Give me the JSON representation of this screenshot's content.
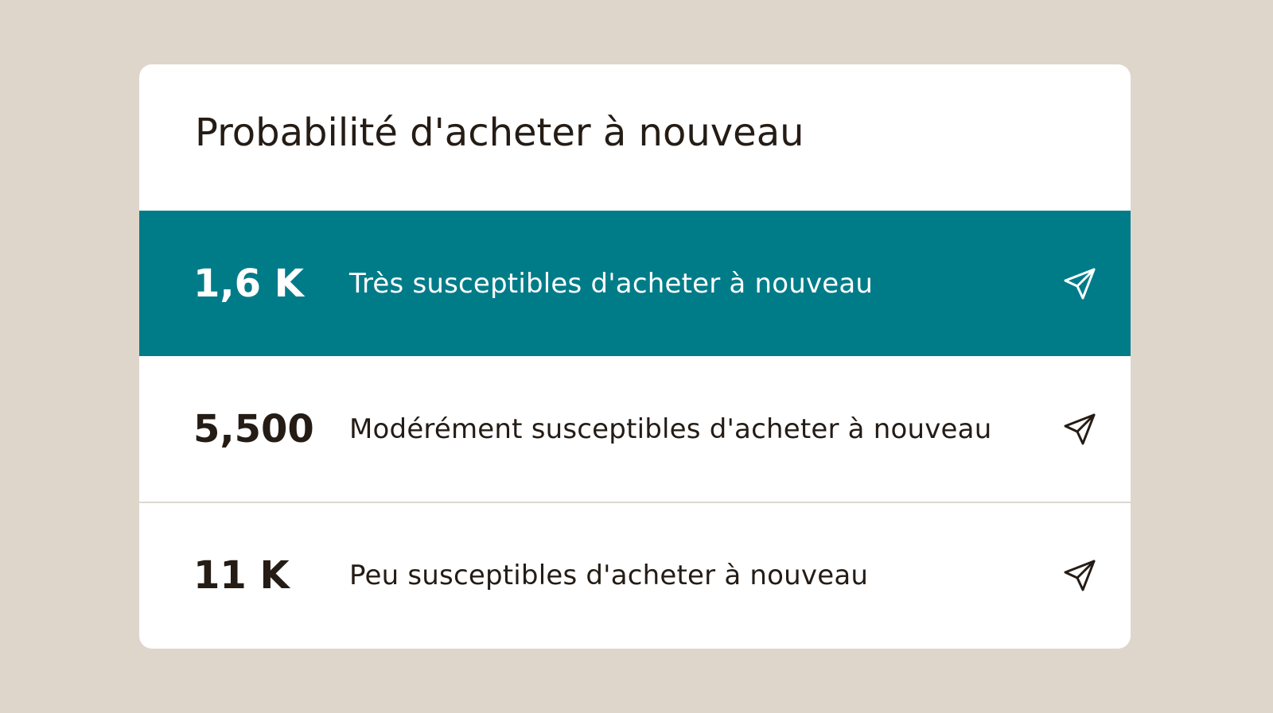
{
  "card": {
    "title": "Probabilité d'acheter à nouveau"
  },
  "rows": [
    {
      "count": "1,6 K",
      "label": "Très susceptibles d'acheter à nouveau",
      "selected": true,
      "icon": "send-icon"
    },
    {
      "count": "5,500",
      "label": "Modérément susceptibles d'acheter à nouveau",
      "selected": false,
      "icon": "send-icon"
    },
    {
      "count": "11 K",
      "label": "Peu susceptibles d'acheter à nouveau",
      "selected": false,
      "icon": "send-icon"
    }
  ],
  "colors": {
    "background": "#dfd6cb",
    "card": "#ffffff",
    "selected_row": "#007c89",
    "text": "#241c15"
  }
}
